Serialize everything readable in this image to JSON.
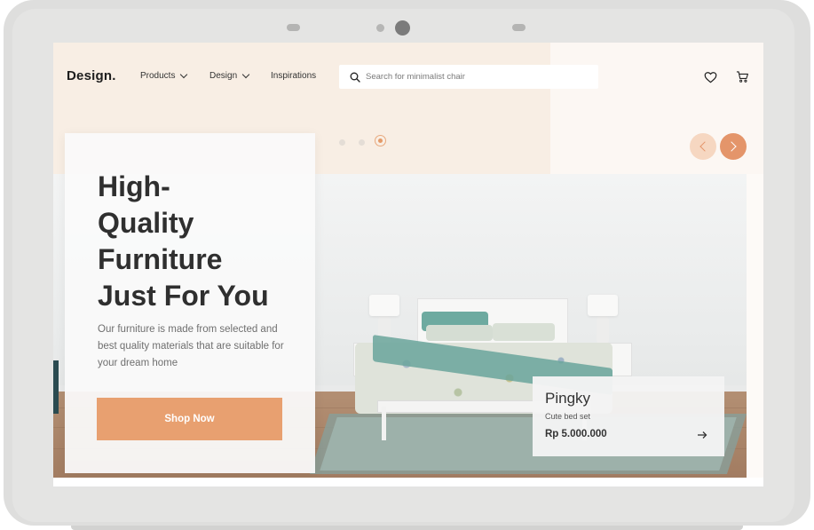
{
  "brand": {
    "logo": "Design.",
    "accent": "#e8a070"
  },
  "nav": {
    "items": [
      {
        "label": "Products",
        "has_dropdown": true
      },
      {
        "label": "Design",
        "has_dropdown": true
      },
      {
        "label": "Inspirations",
        "has_dropdown": false
      }
    ]
  },
  "search": {
    "placeholder": "Search for minimalist chair",
    "value": ""
  },
  "header_icons": {
    "wishlist": "heart-icon",
    "cart": "cart-icon"
  },
  "carousel": {
    "slide_count": 3,
    "active_index": 2,
    "prev_icon": "chevron-left-icon",
    "next_icon": "chevron-right-icon"
  },
  "hero": {
    "headline_lines": [
      "High-",
      "Quality",
      "Furniture",
      "Just For You"
    ],
    "subtext": "Our furniture is made from selected and best quality materials that are suitable for your dream home",
    "cta_label": "Shop Now"
  },
  "product": {
    "name": "Pingky",
    "description": "Cute bed set",
    "price": "Rp 5.000.000",
    "link_icon": "arrow-right-icon"
  }
}
